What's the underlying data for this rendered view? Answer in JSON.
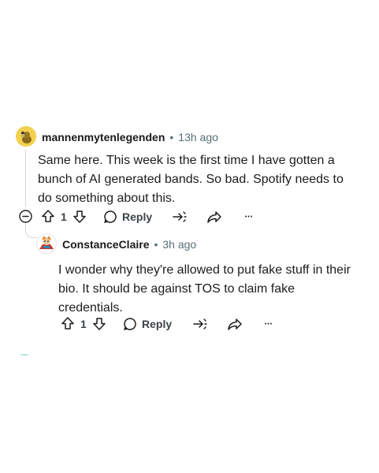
{
  "comments": [
    {
      "username": "mannenmytenlegenden",
      "separator": "•",
      "time": "13h ago",
      "text": "Same here. This week is the first time I have gotten a bunch of AI generated bands. So bad. Spotify needs to do something about this.",
      "vote_count": "1",
      "reply_label": "Reply",
      "more_label": "•••"
    },
    {
      "username": "ConstanceClaire",
      "separator": "•",
      "time": "3h ago",
      "text": "I wonder why they're allowed to put fake stuff in their bio. It should be against TOS to claim fake credentials.",
      "vote_count": "1",
      "reply_label": "Reply",
      "more_label": "•••"
    }
  ],
  "icons": {
    "collapse": "collapse-minus-icon",
    "upvote": "arrow-up-icon",
    "downvote": "arrow-down-icon",
    "reply": "chat-bubble-icon",
    "award": "award-icon",
    "share": "share-icon",
    "more": "more-options-icon"
  },
  "colors": {
    "username": "#1a1a1b",
    "meta": "#576f76",
    "action": "#3c4448",
    "thread_line": "#d0d6d8",
    "avatar1_bg": "#f5d45a",
    "avatar2_bg": "#ffffff"
  }
}
